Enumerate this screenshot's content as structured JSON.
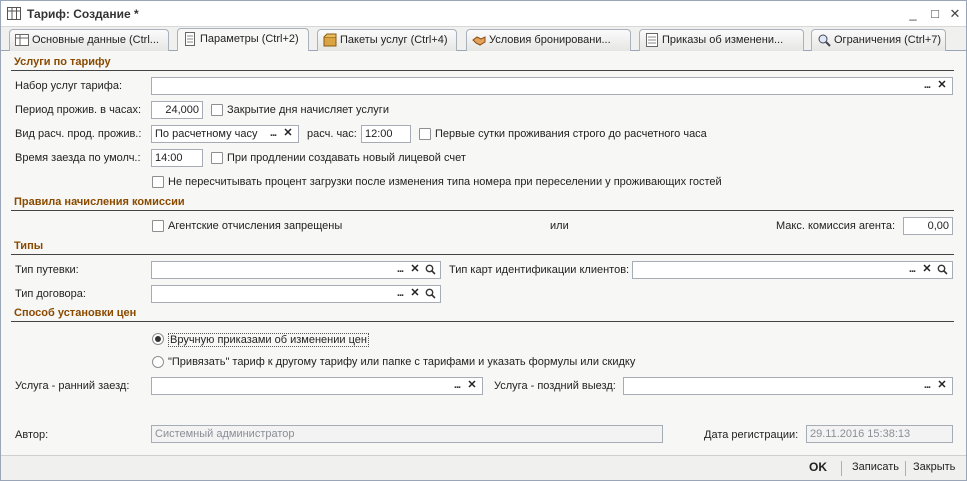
{
  "window": {
    "title": "Тариф: Создание *",
    "minimize_glyph": "_",
    "maximize_glyph": "□",
    "close_glyph": "✕"
  },
  "tabs": [
    {
      "label": "Основные данные (Ctrl...",
      "icon": "table-icon"
    },
    {
      "label": "Параметры (Ctrl+2)",
      "icon": "document-icon"
    },
    {
      "label": "Пакеты услуг (Ctrl+4)",
      "icon": "package-icon"
    },
    {
      "label": "Условия бронировани...",
      "icon": "handshake-icon"
    },
    {
      "label": "Приказы об изменени...",
      "icon": "list-icon"
    },
    {
      "label": "Ограничения (Ctrl+7)",
      "icon": "magnifier-icon"
    }
  ],
  "active_tab": 1,
  "services": {
    "section_title": "Услуги по тарифу",
    "set_label": "Набор услуг тарифа:",
    "set_value": "",
    "period_label": "Период прожив. в часах:",
    "period_value": "24,000",
    "day_close_label": "Закрытие дня начисляет услуги",
    "calc_type_label": "Вид расч. прод. прожив.:",
    "calc_type_value": "По расчетному часу",
    "calc_hour_label": "расч. час:",
    "calc_hour_value": "12:00",
    "first_day_label": "Первые сутки проживания строго до расчетного часа",
    "checkin_label": "Время заезда по умолч.:",
    "checkin_value": "14:00",
    "new_account_label": "При продлении создавать новый лицевой счет",
    "no_recalc_label": "Не пересчитывать процент загрузки после изменения типа номера при переселении у проживающих гостей"
  },
  "commission": {
    "section_title": "Правила начисления комиссии",
    "agent_forbidden_label": "Агентские отчисления запрещены",
    "or_label": "или",
    "max_label": "Макс. комиссия агента:",
    "max_value": "0,00"
  },
  "types": {
    "section_title": "Типы",
    "voucher_label": "Тип путевки:",
    "voucher_value": "",
    "card_label": "Тип карт идентификации клиентов:",
    "card_value": "",
    "contract_label": "Тип договора:",
    "contract_value": ""
  },
  "prices": {
    "section_title": "Способ установки цен",
    "option_manual": "Вручную приказами об изменении цен",
    "option_bind": "\"Привязать\" тариф к другому тарифу или папке с тарифами и указать формулы или скидку",
    "selected_option": "manual",
    "early_label": "Услуга - ранний заезд:",
    "early_value": "",
    "late_label": "Услуга - поздний выезд:",
    "late_value": ""
  },
  "footer_info": {
    "author_label": "Автор:",
    "author_value": "Системный администратор",
    "reg_date_label": "Дата регистрации:",
    "reg_date_value": "29.11.2016 15:38:13"
  },
  "buttons": {
    "ok": "OK",
    "save": "Записать",
    "close": "Закрыть"
  },
  "colors": {
    "section_title": "#8a4a00",
    "window_border": "#9aa6b8"
  }
}
